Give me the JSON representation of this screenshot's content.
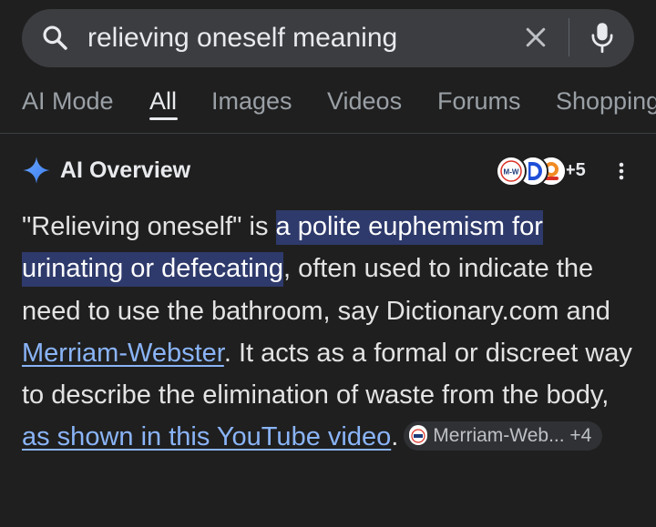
{
  "search": {
    "query": "relieving oneself meaning"
  },
  "tabs": [
    {
      "label": "AI Mode",
      "active": false
    },
    {
      "label": "All",
      "active": true
    },
    {
      "label": "Images",
      "active": false
    },
    {
      "label": "Videos",
      "active": false
    },
    {
      "label": "Forums",
      "active": false
    },
    {
      "label": "Shopping",
      "active": false
    }
  ],
  "overview": {
    "title": "AI Overview",
    "sources_more": "+5",
    "source_avatar_texts": [
      "M-W"
    ],
    "text_intro": "\"Relieving oneself\" is ",
    "highlight": "a polite euphemism for urinating or defecating",
    "text_mid": ", often used to indicate the need to use the bathroom, say Dictionary.com and ",
    "link_mw": "Merriam-Webster",
    "text_after_link": ". It acts as a formal or discreet way to describe the elimination of waste from the body, ",
    "link_youtube": "as shown in this YouTube video",
    "text_end": ".",
    "chip_label": "Merriam-Web...",
    "chip_more": "+4"
  },
  "colors": {
    "background": "#1f1f1f",
    "search_bar": "#3c3d40",
    "highlight": "#2e3a6b",
    "link": "#8ab4f8",
    "spark": "#4c8df6"
  },
  "icons": [
    "search-icon",
    "clear-icon",
    "mic-icon",
    "ai-spark-icon",
    "more-vert-icon"
  ]
}
